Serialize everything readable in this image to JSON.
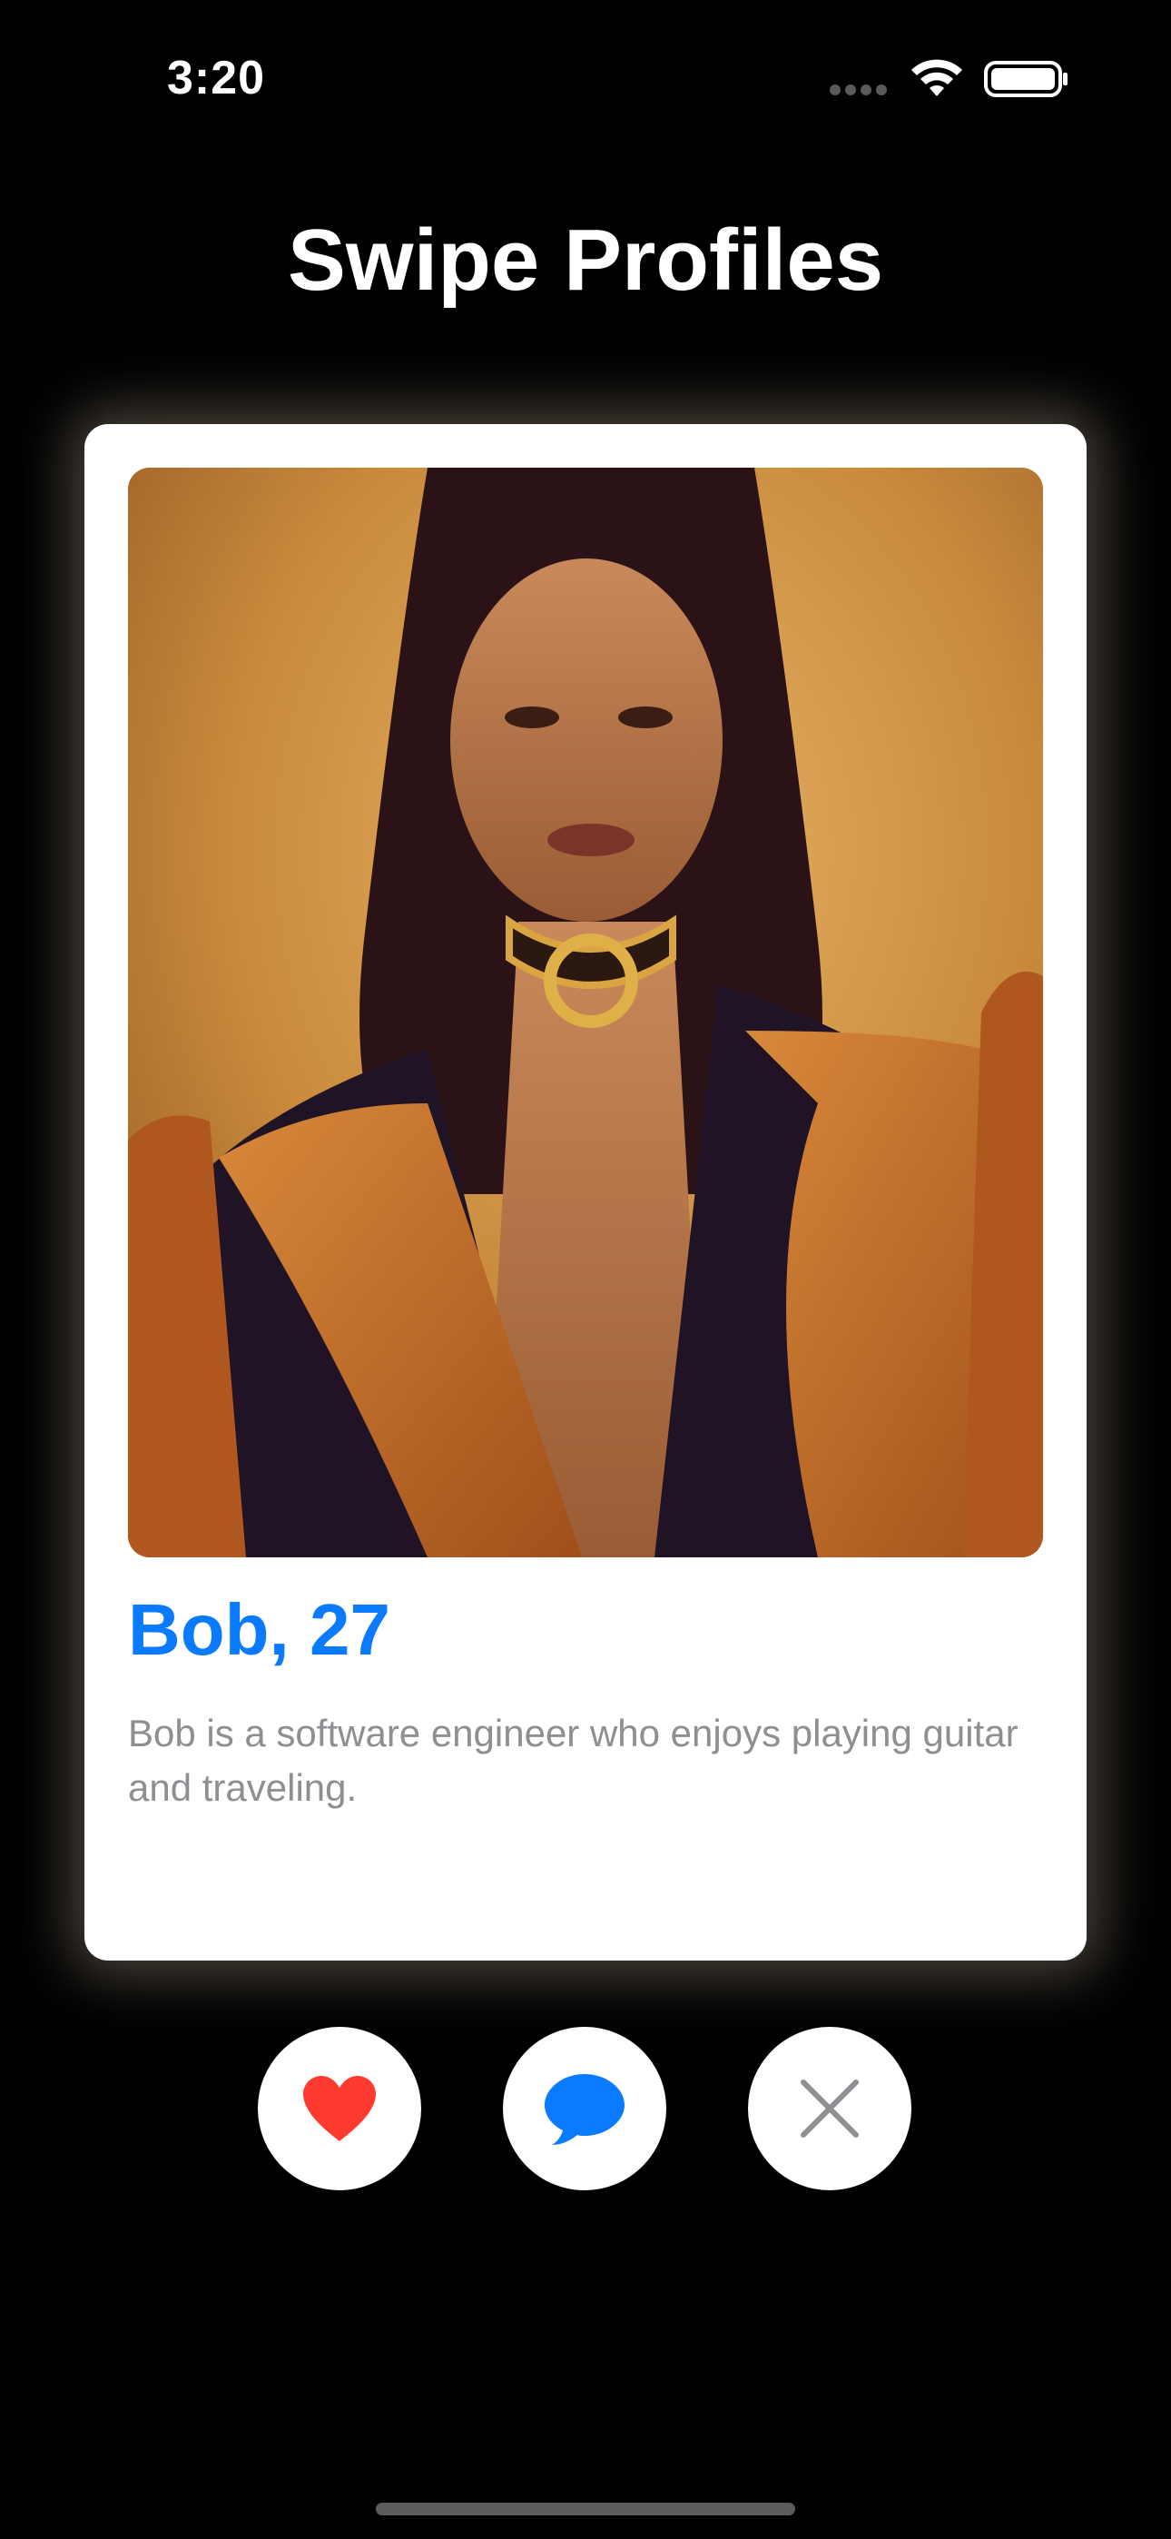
{
  "status_bar": {
    "time": "3:20"
  },
  "header": {
    "title": "Swipe Profiles"
  },
  "profile": {
    "name_age": "Bob, 27",
    "bio": "Bob is a software engineer who enjoys playing guitar and traveling."
  },
  "actions": [
    {
      "name": "like",
      "icon": "heart-icon",
      "color": "#ff3b30"
    },
    {
      "name": "message",
      "icon": "chat-bubble-icon",
      "color": "#0a7aff"
    },
    {
      "name": "dismiss",
      "icon": "close-icon",
      "color": "#8e8e93"
    }
  ],
  "colors": {
    "background": "#000000",
    "card": "#ffffff",
    "accent": "#0a7aff",
    "bio_text": "#8e8e93",
    "like": "#ff3b30"
  }
}
